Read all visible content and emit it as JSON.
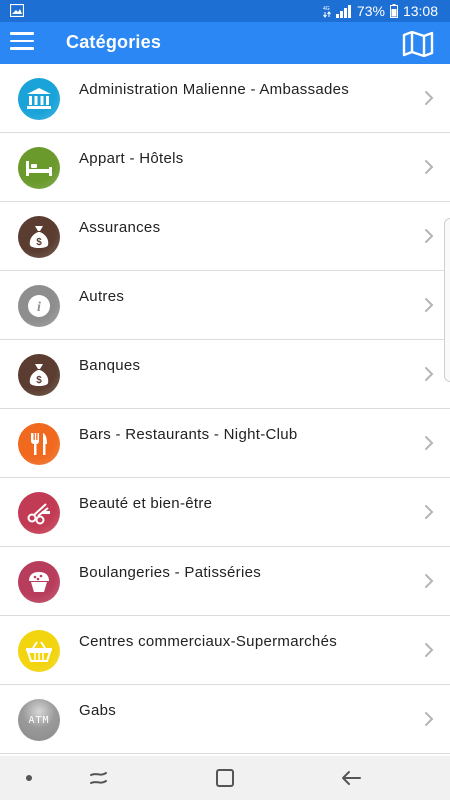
{
  "status": {
    "battery_text": "73%",
    "time": "13:08",
    "icons": [
      "image-icon",
      "data-icon",
      "signal-icon",
      "battery-icon"
    ]
  },
  "header": {
    "title": "Catégories",
    "menu_icon": "hamburger-icon",
    "map_icon": "map-icon"
  },
  "categories": [
    {
      "label": "Administration Malienne - Ambassades",
      "icon": "bank-icon",
      "color": "#1aa3d9"
    },
    {
      "label": "Appart - Hôtels",
      "icon": "bed-icon",
      "color": "#6a9a2c"
    },
    {
      "label": "Assurances",
      "icon": "money-bag-icon",
      "color": "#5a3d30"
    },
    {
      "label": "Autres",
      "icon": "info-icon",
      "color": "#8e8e8e"
    },
    {
      "label": "Banques",
      "icon": "money-bag-icon",
      "color": "#5a3d30"
    },
    {
      "label": "Bars - Restaurants - Night-Club",
      "icon": "fork-knife-icon",
      "color": "#f0691e"
    },
    {
      "label": "Beauté et bien-être",
      "icon": "scissors-comb-icon",
      "color": "#c23b54"
    },
    {
      "label": "Boulangeries - Patisséries",
      "icon": "cupcake-icon",
      "color": "#b83d5c"
    },
    {
      "label": "Centres commerciaux-Supermarchés",
      "icon": "basket-icon",
      "color": "#f2d40f"
    },
    {
      "label": "Gabs",
      "icon": "atm-icon",
      "color": "#8a8a8a",
      "text": "ATM"
    }
  ],
  "navbar": {
    "icons": [
      "dot-icon",
      "recents-icon",
      "home-icon",
      "back-icon"
    ]
  }
}
